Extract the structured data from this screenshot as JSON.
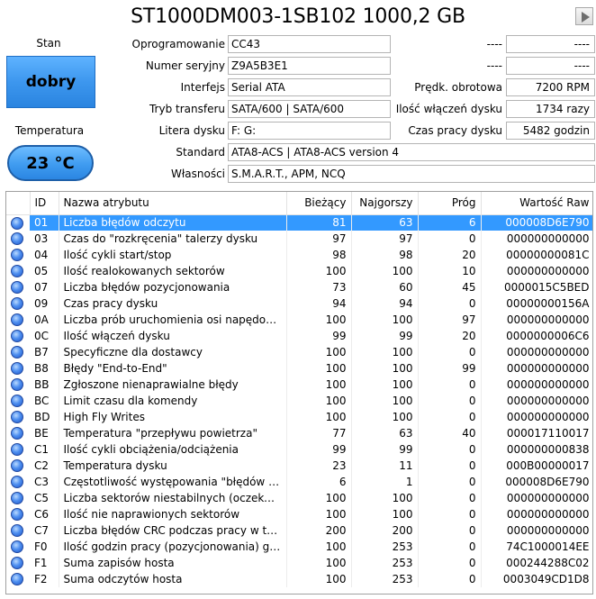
{
  "title": "ST1000DM003-1SB102 1000,2 GB",
  "status": {
    "label": "Stan",
    "value": "dobry"
  },
  "temperature": {
    "label": "Temperatura",
    "value": "23 °C"
  },
  "fields": {
    "firmware": {
      "label": "Oprogramowanie",
      "value": "CC43"
    },
    "serial": {
      "label": "Numer seryjny",
      "value": "Z9A5B3E1"
    },
    "interface": {
      "label": "Interfejs",
      "value": "Serial ATA"
    },
    "transfer": {
      "label": "Tryb transferu",
      "value": "SATA/600 | SATA/600"
    },
    "letter": {
      "label": "Litera dysku",
      "value": "F: G:"
    },
    "standard": {
      "label": "Standard",
      "value": "ATA8-ACS | ATA8-ACS version 4"
    },
    "features": {
      "label": "Własności",
      "value": "S.M.A.R.T., APM, NCQ"
    }
  },
  "right_fields": {
    "blank1": {
      "label": "----",
      "value": "----"
    },
    "blank2": {
      "label": "----",
      "value": "----"
    },
    "rpm": {
      "label": "Prędk. obrotowa",
      "value": "7200 RPM"
    },
    "power_count": {
      "label": "Ilość włączeń dysku",
      "value": "1734 razy"
    },
    "power_hours": {
      "label": "Czas pracy dysku",
      "value": "5482 godzin"
    }
  },
  "table": {
    "columns": [
      "",
      "ID",
      "Nazwa atrybutu",
      "Bieżący",
      "Najgorszy",
      "Próg",
      "Wartość Raw"
    ],
    "selected_index": 0,
    "rows": [
      {
        "id": "01",
        "name": "Liczba błędów odczytu",
        "cur": "81",
        "worst": "63",
        "thr": "6",
        "raw": "000008D6E790"
      },
      {
        "id": "03",
        "name": "Czas do \"rozkręcenia\" talerzy dysku",
        "cur": "97",
        "worst": "97",
        "thr": "0",
        "raw": "000000000000"
      },
      {
        "id": "04",
        "name": "Ilość cykli start/stop",
        "cur": "98",
        "worst": "98",
        "thr": "20",
        "raw": "00000000081C"
      },
      {
        "id": "05",
        "name": "Ilość realokowanych sektorów",
        "cur": "100",
        "worst": "100",
        "thr": "10",
        "raw": "000000000000"
      },
      {
        "id": "07",
        "name": "Liczba błędów pozycjonowania",
        "cur": "73",
        "worst": "60",
        "thr": "45",
        "raw": "0000015C5BED"
      },
      {
        "id": "09",
        "name": "Czas pracy dysku",
        "cur": "94",
        "worst": "94",
        "thr": "0",
        "raw": "00000000156A"
      },
      {
        "id": "0A",
        "name": "Liczba prób uruchomienia osi napędowej...",
        "cur": "100",
        "worst": "100",
        "thr": "97",
        "raw": "000000000000"
      },
      {
        "id": "0C",
        "name": "Ilość włączeń dysku",
        "cur": "99",
        "worst": "99",
        "thr": "20",
        "raw": "0000000006C6"
      },
      {
        "id": "B7",
        "name": "Specyficzne dla dostawcy",
        "cur": "100",
        "worst": "100",
        "thr": "0",
        "raw": "000000000000"
      },
      {
        "id": "B8",
        "name": "Błędy \"End-to-End\"",
        "cur": "100",
        "worst": "100",
        "thr": "99",
        "raw": "000000000000"
      },
      {
        "id": "BB",
        "name": "Zgłoszone nienaprawialne błędy",
        "cur": "100",
        "worst": "100",
        "thr": "0",
        "raw": "000000000000"
      },
      {
        "id": "BC",
        "name": "Limit czasu dla komendy",
        "cur": "100",
        "worst": "100",
        "thr": "0",
        "raw": "000000000000"
      },
      {
        "id": "BD",
        "name": "High Fly Writes",
        "cur": "100",
        "worst": "100",
        "thr": "0",
        "raw": "000000000000"
      },
      {
        "id": "BE",
        "name": "Temperatura \"przepływu powietrza\"",
        "cur": "77",
        "worst": "63",
        "thr": "40",
        "raw": "000017110017"
      },
      {
        "id": "C1",
        "name": "Ilość cykli obciążenia/odciążenia",
        "cur": "99",
        "worst": "99",
        "thr": "0",
        "raw": "000000000838"
      },
      {
        "id": "C2",
        "name": "Temperatura dysku",
        "cur": "23",
        "worst": "11",
        "thr": "0",
        "raw": "000B00000017"
      },
      {
        "id": "C3",
        "name": "Częstotliwość występowania \"błędów w lo...",
        "cur": "6",
        "worst": "1",
        "thr": "0",
        "raw": "000008D6E790"
      },
      {
        "id": "C5",
        "name": "Liczba sektorów niestabilnych (oczekując...",
        "cur": "100",
        "worst": "100",
        "thr": "0",
        "raw": "000000000000"
      },
      {
        "id": "C6",
        "name": "Ilość nie naprawionych sektorów",
        "cur": "100",
        "worst": "100",
        "thr": "0",
        "raw": "000000000000"
      },
      {
        "id": "C7",
        "name": "Liczba błędów CRC podczas pracy w trybi...",
        "cur": "200",
        "worst": "200",
        "thr": "0",
        "raw": "000000000000"
      },
      {
        "id": "F0",
        "name": "Ilość godzin pracy (pozycjonowania) gło...",
        "cur": "100",
        "worst": "253",
        "thr": "0",
        "raw": "74C1000014EE"
      },
      {
        "id": "F1",
        "name": "Suma zapisów hosta",
        "cur": "100",
        "worst": "253",
        "thr": "0",
        "raw": "000244288C02"
      },
      {
        "id": "F2",
        "name": "Suma odczytów hosta",
        "cur": "100",
        "worst": "253",
        "thr": "0",
        "raw": "0003049CD1D8"
      }
    ]
  },
  "colors": {
    "selection": "#3399ff",
    "status_blue": "#3d97ee",
    "dot_blue": "#4e8ff0"
  },
  "icons": {
    "play": "play-icon",
    "row_status": "status-dot-icon"
  }
}
